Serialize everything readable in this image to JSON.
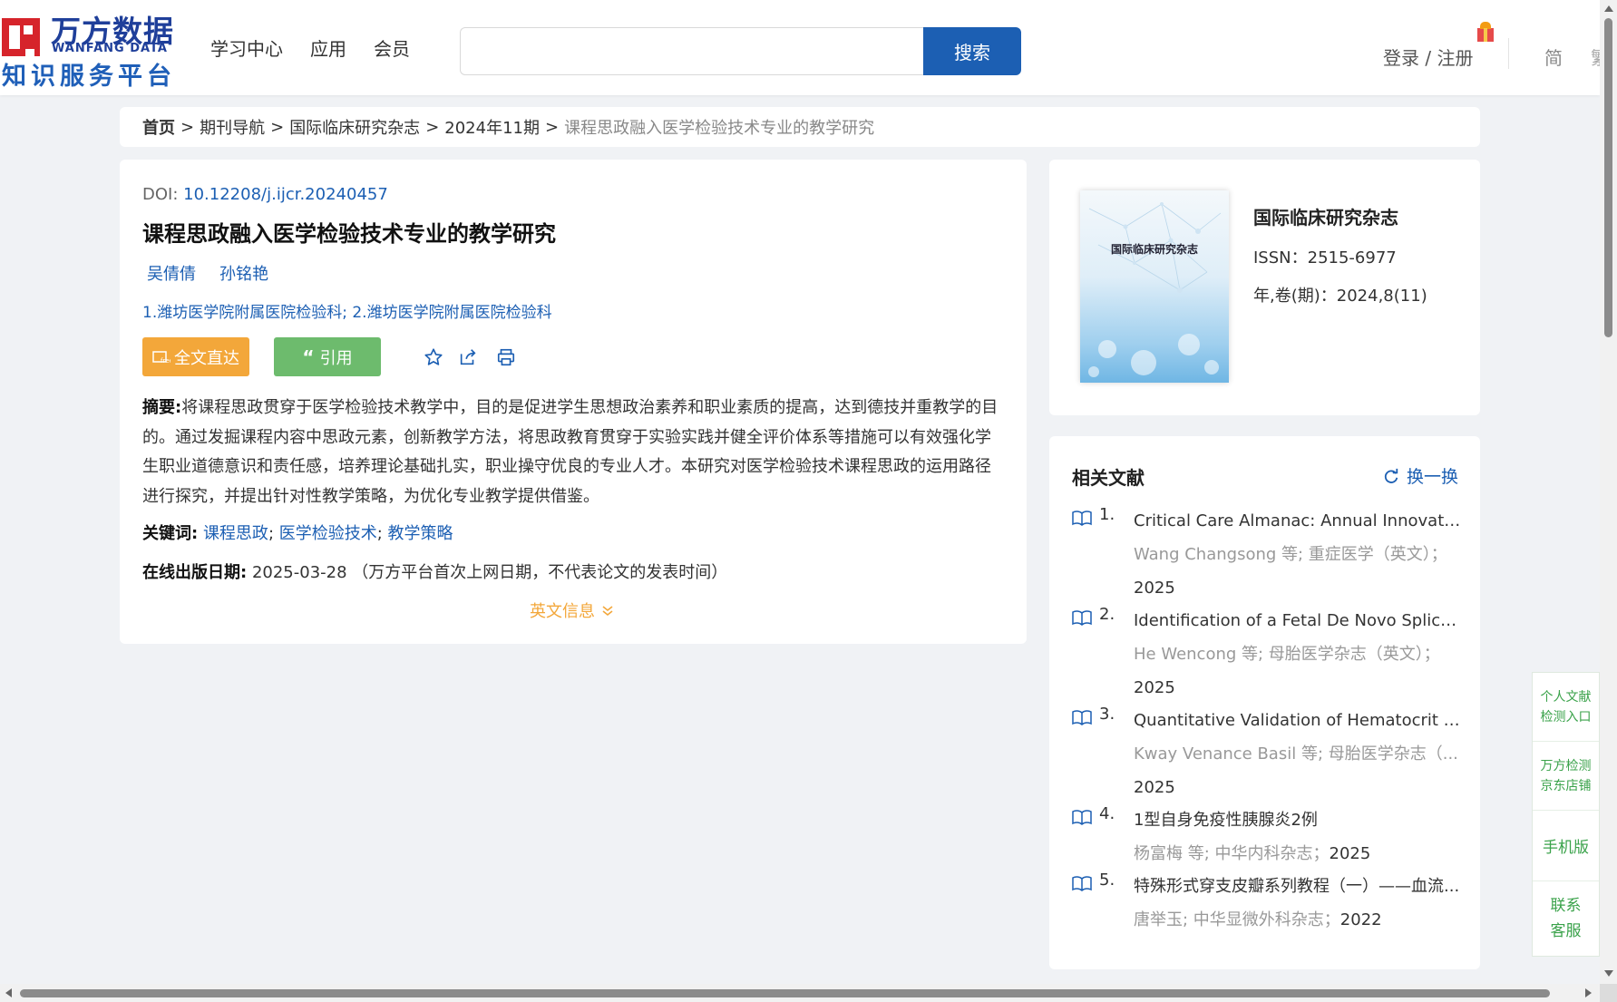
{
  "header": {
    "logo": {
      "cn_top": "万方数据",
      "en": "WANFANG DATA",
      "cn_bottom": "知识服务平台"
    },
    "nav": [
      "学习中心",
      "应用",
      "会员"
    ],
    "search": {
      "value": "",
      "placeholder": "",
      "button": "搜索"
    },
    "login": "登录 / 注册",
    "lang": "简",
    "lang2": "繁"
  },
  "breadcrumb": {
    "items": [
      "首页",
      "期刊导航",
      "国际临床研究杂志",
      "2024年11期"
    ],
    "current": "课程思政融入医学检验技术专业的教学研究",
    "separator": ">"
  },
  "article": {
    "doi_label": "DOI:",
    "doi": "10.12208/j.ijcr.20240457",
    "title": "课程思政融入医学检验技术专业的教学研究",
    "authors": [
      "吴倩倩",
      "孙铭艳"
    ],
    "affiliations": "1.潍坊医学院附属医院检验科; 2.潍坊医学院附属医院检验科",
    "btn_fulltext": "全文直达",
    "btn_cite": "引用",
    "abstract_label": "摘要:",
    "abstract": "将课程思政贯穿于医学检验技术教学中，目的是促进学生思想政治素养和职业素质的提高，达到德技并重教学的目的。通过发掘课程内容中思政元素，创新教学方法，将思政教育贯穿于实验实践并健全评价体系等措施可以有效强化学生职业道德意识和责任感，培养理论基础扎实，职业操守优良的专业人才。本研究对医学检验技术课程思政的运用路径进行探究，并提出针对性教学策略，为优化专业教学提供借鉴。",
    "keywords_label": "关键词:",
    "keywords": [
      "课程思政",
      "医学检验技术",
      "教学策略"
    ],
    "pubdate_label": "在线出版日期:",
    "pubdate": "2025-03-28",
    "pubdate_note": "（万方平台首次上网日期，不代表论文的发表时间）",
    "english_info": "英文信息"
  },
  "journal": {
    "cover_title": "国际临床研究杂志",
    "name": "国际临床研究杂志",
    "issn_label": "ISSN：",
    "issn": "2515-6977",
    "vol_label": "年,卷(期)：",
    "vol": "2024,8(11)"
  },
  "related": {
    "title": "相关文献",
    "refresh": "换一换",
    "items": [
      {
        "num": "1.",
        "title": "Critical Care Almanac: Annual Innovation...",
        "meta": "Wang Changsong  等;  重症医学（英文）；",
        "year": "2025"
      },
      {
        "num": "2.",
        "title": "Identification of a Fetal De Novo Splice ...",
        "meta": "He Wencong  等;  母胎医学杂志（英文）；",
        "year": "2025"
      },
      {
        "num": "3.",
        "title": "Quantitative Validation of Hematocrit Pe...",
        "meta": "Kway Venance Basil  等;  母胎医学杂志（...",
        "year": "2025"
      },
      {
        "num": "4.",
        "title": "1型自身免疫性胰腺炎2例",
        "meta": "杨富梅  等;  中华内科杂志；",
        "year": "2025"
      },
      {
        "num": "5.",
        "title": "特殊形式穿支皮瓣系列教程（一）——血流...",
        "meta": "唐举玉; 中华显微外科杂志；",
        "year": "2022"
      }
    ]
  },
  "side_panel": {
    "item1": [
      "个人文献",
      "检测入口"
    ],
    "item2": [
      "万方检测",
      "京东店铺"
    ],
    "item3": "手机版",
    "item4": [
      "联系",
      "客服"
    ]
  },
  "colors": {
    "brand_blue": "#1c5fb3",
    "logo_red": "#d6242b",
    "fulltext_orange": "#f3a73a",
    "cite_green": "#6dbb6d",
    "side_green": "#3aa24a"
  }
}
